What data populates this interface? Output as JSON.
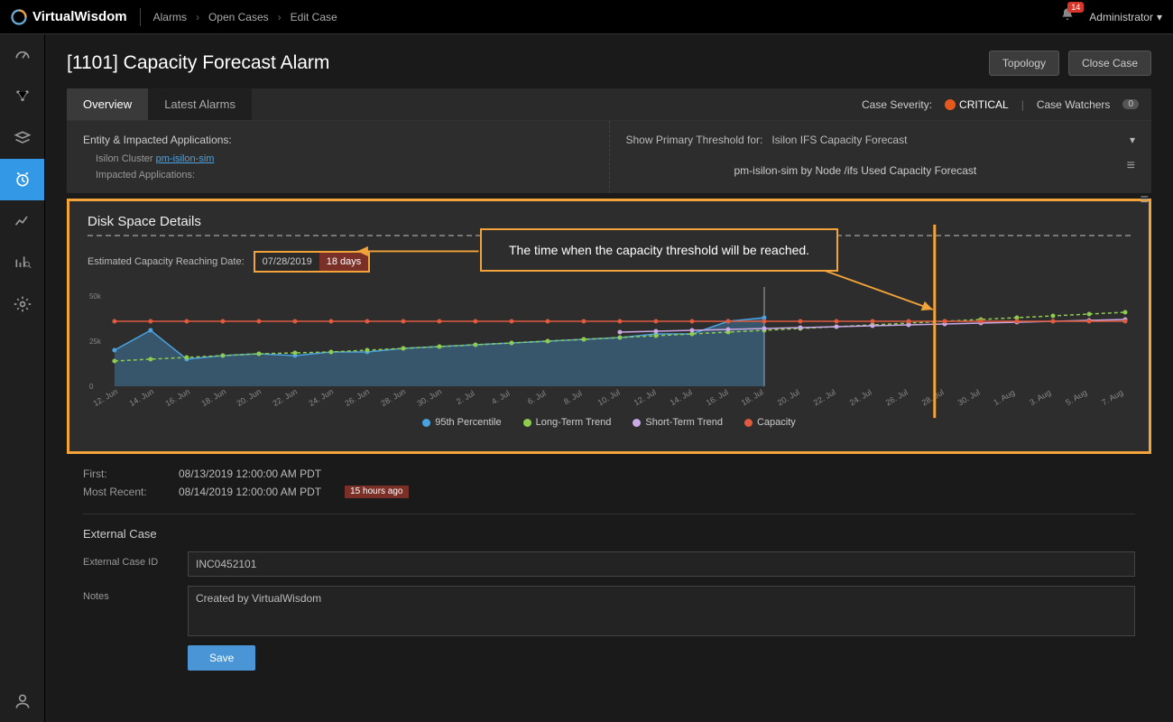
{
  "app": {
    "name": "VirtualWisdom"
  },
  "breadcrumb": [
    "Alarms",
    "Open Cases",
    "Edit Case"
  ],
  "notifications": {
    "count": "14"
  },
  "user": {
    "name": "Administrator"
  },
  "page": {
    "title": "[1101] Capacity Forecast Alarm"
  },
  "actions": {
    "topology": "Topology",
    "close_case": "Close Case"
  },
  "tabs": {
    "overview": "Overview",
    "latest": "Latest Alarms"
  },
  "case": {
    "severity_label": "Case Severity:",
    "severity_value": "CRITICAL",
    "watchers_label": "Case Watchers",
    "watchers_count": "0"
  },
  "entity": {
    "header": "Entity & Impacted Applications:",
    "cluster_label": "Isilon Cluster",
    "cluster_link": "pm-isilon-sim",
    "impacted_label": "Impacted Applications:"
  },
  "threshold": {
    "label": "Show Primary Threshold for:",
    "value": "Isilon IFS Capacity Forecast",
    "subtitle": "pm-isilon-sim by Node /ifs Used Capacity Forecast"
  },
  "disk": {
    "title": "Disk Space Details",
    "est_label": "Estimated Capacity Reaching Date:",
    "est_date": "07/28/2019",
    "est_days": "18 days",
    "callout": "The time when the capacity threshold will be reached."
  },
  "chart_data": {
    "type": "line",
    "title": "Disk Space Details",
    "xlabel": "",
    "ylabel": "",
    "ylim": [
      0,
      55000
    ],
    "y_ticks": [
      "0",
      "25k",
      "50k"
    ],
    "categories": [
      "12. Jun",
      "14. Jun",
      "16. Jun",
      "18. Jun",
      "20. Jun",
      "22. Jun",
      "24. Jun",
      "26. Jun",
      "28. Jun",
      "30. Jun",
      "2. Jul",
      "4. Jul",
      "6. Jul",
      "8. Jul",
      "10. Jul",
      "12. Jul",
      "14. Jul",
      "16. Jul",
      "18. Jul",
      "20. Jul",
      "22. Jul",
      "24. Jul",
      "26. Jul",
      "28. Jul",
      "30. Jul",
      "1. Aug",
      "3. Aug",
      "5. Aug",
      "7. Aug"
    ],
    "series": [
      {
        "name": "95th Percentile",
        "color": "#4aa3e0",
        "style": "area",
        "values": [
          20000,
          31000,
          15000,
          17000,
          18000,
          17000,
          19000,
          19000,
          21000,
          22000,
          23000,
          24000,
          25000,
          26000,
          27000,
          29000,
          29000,
          36000,
          38000,
          null,
          null,
          null,
          null,
          null,
          null,
          null,
          null,
          null,
          null
        ]
      },
      {
        "name": "Long-Term Trend",
        "color": "#8ecb4f",
        "style": "dashed",
        "values": [
          14000,
          15000,
          16000,
          17000,
          18000,
          18500,
          19000,
          20000,
          21000,
          22000,
          23000,
          24000,
          25000,
          26000,
          27000,
          28000,
          29000,
          30000,
          31000,
          32000,
          33000,
          34000,
          35000,
          36000,
          37000,
          38000,
          39000,
          40000,
          41000
        ]
      },
      {
        "name": "Short-Term Trend",
        "color": "#caa9e6",
        "style": "line",
        "values": [
          null,
          null,
          null,
          null,
          null,
          null,
          null,
          null,
          null,
          null,
          null,
          null,
          null,
          null,
          30000,
          30500,
          31000,
          31500,
          32000,
          32500,
          33000,
          33500,
          34000,
          34500,
          35000,
          35500,
          36000,
          36500,
          37000
        ]
      },
      {
        "name": "Capacity",
        "color": "#e05a3e",
        "style": "line",
        "values": [
          36000,
          36000,
          36000,
          36000,
          36000,
          36000,
          36000,
          36000,
          36000,
          36000,
          36000,
          36000,
          36000,
          36000,
          36000,
          36000,
          36000,
          36000,
          36000,
          36000,
          36000,
          36000,
          36000,
          36000,
          36000,
          36000,
          36000,
          36000,
          36000
        ]
      }
    ],
    "legend": [
      "95th Percentile",
      "Long-Term Trend",
      "Short-Term Trend",
      "Capacity"
    ],
    "threshold_reached_x_index": 23,
    "observed_end_x_index": 18
  },
  "details": {
    "first_label": "First:",
    "first_value": "08/13/2019 12:00:00 AM PDT",
    "recent_label": "Most Recent:",
    "recent_value": "08/14/2019 12:00:00 AM PDT",
    "recent_ago": "15 hours ago"
  },
  "external": {
    "title": "External Case",
    "id_label": "External Case ID",
    "id_value": "INC0452101",
    "notes_label": "Notes",
    "notes_value": "Created by VirtualWisdom",
    "save": "Save"
  },
  "legend_colors": {
    "p95": "#4aa3e0",
    "long": "#8ecb4f",
    "short": "#caa9e6",
    "cap": "#e05a3e"
  }
}
